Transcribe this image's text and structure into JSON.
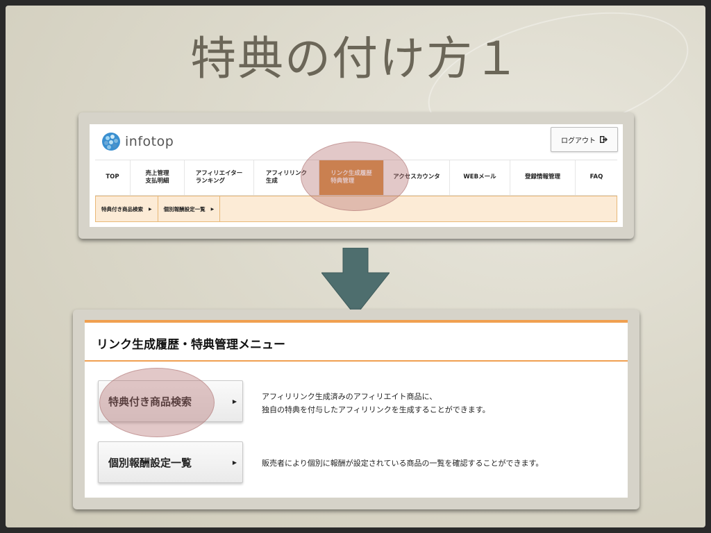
{
  "slide": {
    "title": "特典の付け方１"
  },
  "header": {
    "logo_text": "infotop",
    "logout_label": "ログアウト",
    "logout_icon": "logout-icon"
  },
  "nav": {
    "items": [
      {
        "label": "TOP"
      },
      {
        "label": "売上管理\n支払明細"
      },
      {
        "label": "アフィリエイター\nランキング"
      },
      {
        "label": "アフィリリンク\n生成"
      },
      {
        "label": "リンク生成履歴\n特典管理"
      },
      {
        "label": "アクセスカウンタ"
      },
      {
        "label": "WEBメール"
      },
      {
        "label": "登録情報管理"
      },
      {
        "label": "FAQ"
      }
    ],
    "active_index": 4,
    "active_color": "#d88b3e"
  },
  "subnav": {
    "items": [
      {
        "label": "特典付き商品検索"
      },
      {
        "label": "個別報酬設定一覧"
      }
    ]
  },
  "menu": {
    "title": "リンク生成履歴・特典管理メニュー",
    "items": [
      {
        "label": "特典付き商品検索",
        "description": "アフィリリンク生成済みのアフィリエイト商品に、\n独自の特典を付与したアフィリリンクを生成することができます。"
      },
      {
        "label": "個別報酬設定一覧",
        "description": "販売者により個別に報酬が設定されている商品の一覧を確認することができます。"
      }
    ]
  },
  "colors": {
    "accent": "#f0a050",
    "arrow": "#4e6e6e",
    "highlight": "#b46e6e"
  }
}
